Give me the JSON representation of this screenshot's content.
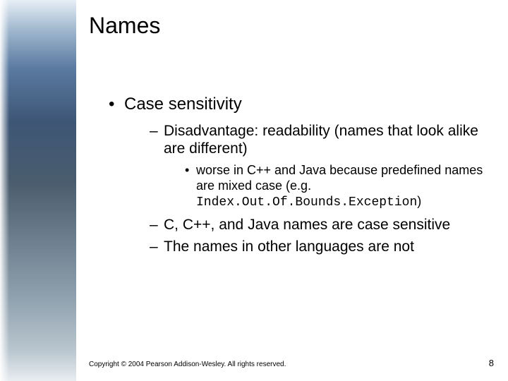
{
  "title": "Names",
  "bullets": {
    "l1_0": "Case sensitivity",
    "l2_0": "Disadvantage: readability (names that look alike are different)",
    "l3_0a": "worse in C++ and Java  because predefined  names are mixed case  (e.g. ",
    "l3_0_code": "Index.Out.Of.Bounds.Exception",
    "l3_0b": ")",
    "l2_1": "C, C++, and Java names are case sensitive",
    "l2_2": "The names in other languages are not"
  },
  "footer": "Copyright © 2004 Pearson Addison-Wesley. All rights reserved.",
  "page_number": "8"
}
